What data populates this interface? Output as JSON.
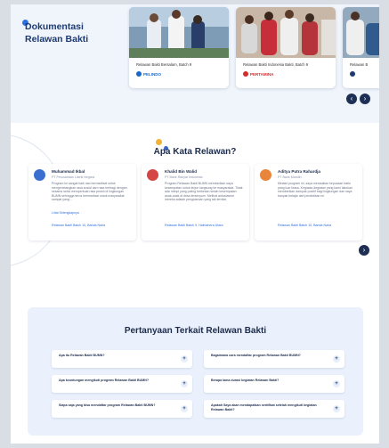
{
  "documentation": {
    "title": "Dokumentasi Relawan Bakti",
    "cards": [
      {
        "caption": "Relawan Bakti Bersalam, Batch 9",
        "brand": "PELINDO",
        "brand_color": "#1769c9"
      },
      {
        "caption": "Relawan Bakti Indonesia Bakti, Batch 9",
        "brand": "PERTAMINA",
        "brand_color": "#d62b2b"
      },
      {
        "caption": "Relawan B",
        "brand": "",
        "brand_color": "#1d3b72"
      }
    ],
    "prev_icon": "chevron-left-icon",
    "next_icon": "chevron-right-icon"
  },
  "testimonials": {
    "title": "Apa Kata Relawan?",
    "items": [
      {
        "name": "Muhammad Ikbal",
        "org": "PT Perusahaan Listrik Negara",
        "text": "Program ini sangat baik dan bermanfaat untuk mengembangkan rasa sosial dari rasa berbagi dengan sesama serta memperkuat rasa peduli di lingkungan BUMN sehingga terus bermanfaat untuk masyarakat sampai yang...",
        "more": "Lihat Selengkapnya",
        "program": "Relawan Bakti Batch 10, Banda Naira",
        "avatar_color": "#3a6fd1"
      },
      {
        "name": "Khalid Bin Walid",
        "org": "PT Bank Rakyat Indonesia",
        "text": "Program Relawan Bakti BUMN memberikan saya kesempatan untuk terjun langsung ke masyarakat. Tidak ada mimpi yang paling berkesan selain kesempatan anak-anak di desa tersenyum. Melihat antusiasme mereka adalah pengalaman yang tak ternilai.",
        "more": "",
        "program": "Relawan Bakti Batch 9, Halmahera Utara",
        "avatar_color": "#d64545"
      },
      {
        "name": "Aditya Putra Rahardja",
        "org": "PT Bank Mandiri",
        "text": "Melalui program ini, saya merasakan kepuasan batin yang luar biasa. Kegiatan-kegiatan yang kami lakukan memberikan dampak positif bagi lingkungan dan saya banyak belajar dari pendidikan ini.",
        "more": "",
        "program": "Relawan Bakti Batch 10, Banda Naira",
        "avatar_color": "#e9853a"
      }
    ],
    "next_icon": "chevron-right-icon"
  },
  "faq": {
    "title": "Pertanyaan Terkait Relawan Bakti",
    "questions": [
      "Apa itu Relawan Bakti BUMN?",
      "Bagaimana cara mendaftar program Relawan Bakti BUMN?",
      "Apa keuntungan mengikuti program Relawan Bakti BUMN?",
      "Berapa lama durasi kegiatan Relawan Bakti?",
      "Siapa saja yang bisa mendaftar program Relawan Bakti BUMN?",
      "Apakah Saya akan mendapatkan sertifikat setelah mengikuti kegiatan Relawan Bakti?"
    ],
    "toggle_symbol": "+"
  }
}
